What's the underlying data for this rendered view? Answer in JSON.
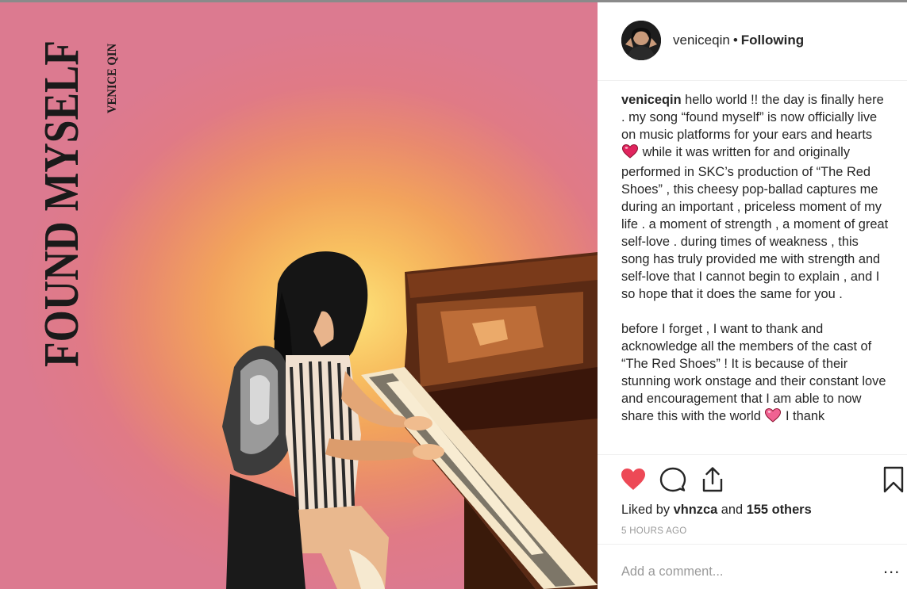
{
  "post": {
    "media": {
      "cover_title": "FOUND MYSELF",
      "cover_artist": "VENICE QIN"
    },
    "header": {
      "username": "veniceqin",
      "separator": "•",
      "follow_status": "Following"
    },
    "caption": {
      "username": "veniceqin",
      "paragraph1_a": "hello world !! the day is finally here . my song “found myself” is now officially live on music platforms for your ears and hearts",
      "paragraph1_b": "while it was written for and originally performed in SKC’s production of “The Red Shoes” , this cheesy pop-ballad captures me during an important , priceless moment of my life . a moment of strength , a moment of great self-love . during times of weakness , this song has truly provided me with strength and self-love that I cannot begin to explain , and I so hope that it does the same for you .",
      "paragraph2_a": "before I forget , I want to thank and acknowledge all the members of the cast of “The Red Shoes” ! It is because of their stunning work onstage and their constant love and encouragement that I am able to now share this with the world",
      "paragraph2_b": "I thank"
    },
    "likes": {
      "prefix": "Liked by",
      "first_liker": "vhnzca",
      "connector": "and",
      "others": "155 others"
    },
    "timestamp": "5 HOURS AGO",
    "comment_box": {
      "placeholder": "Add a comment..."
    },
    "more_label": "..."
  },
  "colors": {
    "like_red": "#ed4956",
    "text": "#262626",
    "muted": "#999999",
    "divider": "#efefef"
  },
  "icons": {
    "like": "heart-filled-icon",
    "comment": "comment-bubble-icon",
    "share": "share-upload-icon",
    "save": "bookmark-icon",
    "more": "more-horizontal-icon"
  }
}
